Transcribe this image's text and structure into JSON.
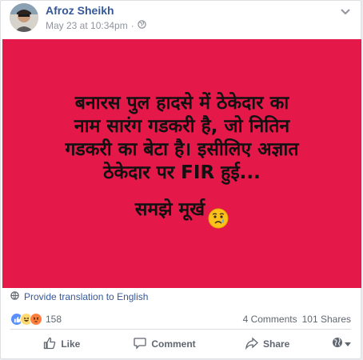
{
  "post": {
    "author": "Afroz Sheikh",
    "timestamp": "May 23 at 10:34pm",
    "separator": "·",
    "privacy_icon": "globe-icon",
    "body": "बनारस पुल हादसे में ठेकेदार का\nनाम सारंग गडकरी है, जो नितिन\nगडकरी का बेटा है। इसीलिए अज्ञात\nठेकेदार पर FIR हुई...\nसमझे मूर्ख",
    "emoji": "sad-face-with-tear",
    "background_color": "#e5184a"
  },
  "translation": {
    "label": "Provide translation to English"
  },
  "reactions": {
    "icons": [
      "like",
      "haha",
      "angry"
    ],
    "count": "158"
  },
  "stats": {
    "comments": "4 Comments",
    "shares": "101 Shares"
  },
  "actions": {
    "like": "Like",
    "comment": "Comment",
    "share": "Share"
  }
}
